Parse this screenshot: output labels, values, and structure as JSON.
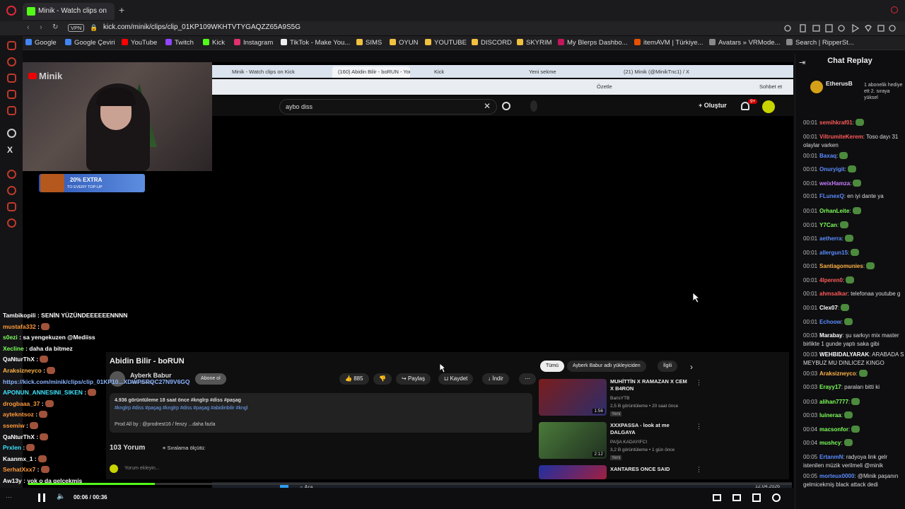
{
  "outer_browser": {
    "tab_title": "Minik - Watch clips on",
    "url": "kick.com/minik/clips/clip_01KP109WKHTVTYGAQZZ65A9S5G",
    "vpn_label": "VPN",
    "bookmarks": [
      "Google",
      "Google Çeviri",
      "YouTube",
      "Twitch",
      "Kick",
      "Instagram",
      "TikTok - Make You...",
      "SIMS",
      "OYUN",
      "YOUTUBE",
      "DISCORD",
      "SKYRIM",
      "My Blerps Dashbo...",
      "itemAVM | Türkiye...",
      "Avatars » VRMode...",
      "Search | RipperSt..."
    ],
    "bookmark_colors": [
      "#4285f4",
      "#4285f4",
      "#ff0000",
      "#9146ff",
      "#53fc18",
      "#e1306c",
      "#eeeeee",
      "#f0c040",
      "#f0c040",
      "#f0c040",
      "#f0c040",
      "#f0c040",
      "#c2185b",
      "#e65100",
      "#888888",
      "#888888"
    ]
  },
  "stream": {
    "channel_watermark": "Minik",
    "promo_text": "20% EXTRA",
    "promo_sub": "TO EVERY TOP-UP",
    "inner_tabs": [
      "Minik - Watch clips on Kick",
      "(160) Abidin Bilir - boRUN - YouT",
      "Kick",
      "Yeni sekme",
      "(21) Minik (@MinikTnc1) / X"
    ],
    "inner_toolbar_right": [
      "Özetle",
      "Sohbet et"
    ],
    "youtube": {
      "search_query": "aybo diss",
      "create_label": "Oluştur",
      "notif_count": "9+",
      "video_title": "Abidin Bilir - boRUN",
      "channel_name": "Ayberk Babur",
      "subscribe_label": "Abone ol",
      "subscribers": "Yeni abone",
      "likes": "885",
      "share_label": "Paylaş",
      "save_label": "Kaydet",
      "download_label": "İndir",
      "views_line": "4.936 görüntüleme  18 saat önce  #knglrp #diss #paşag",
      "tags_line": "#knglrp #diss #paşag #knglrp #diss #paşag #abidinbilir #kngl",
      "prod_line": "Prod All by : @prodrest16 / fenzy ...daha fazla",
      "comments_count": "103 Yorum",
      "sort_label": "Sıralama ölçütü:",
      "comment_placeholder": "Yorum ekleyin...",
      "chips": [
        "Tümü",
        "Ayberk Babur adlı yükleyiciden",
        "İlgili"
      ],
      "recommended": [
        {
          "title": "MUHİTTİN X RAMAZAN X CEM X B4RON",
          "channel": "BarisYTB",
          "meta": "2,5 B görüntüleme • 20 saat önce",
          "badge": "Yeni",
          "duration": "1:56"
        },
        {
          "title": "XXXPASSA - look at me DALGAYA",
          "channel": "PAŞA KADAYIFCI",
          "meta": "3,2 B görüntüleme • 1 gün önce",
          "badge": "Yeni",
          "duration": "2:12"
        },
        {
          "title": "XANTARES ONCE SAID",
          "channel": "",
          "meta": "",
          "badge": "",
          "duration": ""
        }
      ]
    },
    "overlay_chat": [
      {
        "user": "Tambikopili",
        "text": " : SENİN YÜZÜNDEEEEEENNNN",
        "color": "#ffffff"
      },
      {
        "user": "mustafa332",
        "text": " :",
        "color": "#ff9a3c"
      },
      {
        "user": "s0ezi",
        "text": " : sa yengekuzen @Mediiss",
        "color": "#7dff5a"
      },
      {
        "user": "Xecline",
        "text": " : daha da bitmez",
        "color": "#7dff5a"
      },
      {
        "user": "QaNturThX",
        "text": " :",
        "color": "#ffffff"
      },
      {
        "user": "Araksizneyco",
        "text": " :",
        "color": "#ffb347"
      },
      {
        "user": "https://kick.com/minik/clips/clip_01KP10...XDWPSRQC27N9V6GQ",
        "text": "",
        "color": "#8ab4ff"
      },
      {
        "user": "APONUN_ANNESINI_SIKEN",
        "text": " :",
        "color": "#3de5ff"
      },
      {
        "user": "drogbaaa_37",
        "text": " :",
        "color": "#ff9a3c"
      },
      {
        "user": "aytekntsoz",
        "text": " :",
        "color": "#ff9a3c"
      },
      {
        "user": "ssemiw",
        "text": " :",
        "color": "#ff9a3c"
      },
      {
        "user": "QaNturThX",
        "text": " :",
        "color": "#ffffff"
      },
      {
        "user": "Prxlen",
        "text": " :",
        "color": "#3de5ff"
      },
      {
        "user": "Kaanmx_1",
        "text": " :",
        "color": "#ffffff"
      },
      {
        "user": "SerhatXxx7",
        "text": " :",
        "color": "#ff9a3c"
      },
      {
        "user": "Aw13y",
        "text": " : yok o da gelcekmiş",
        "color": "#ffffff"
      }
    ],
    "taskbar_search": "Ara",
    "taskbar_date": "12.04.2026"
  },
  "chat_replay": {
    "title": "Chat Replay",
    "gift_user": "EtherusB",
    "gift_text": "1 abonelik hediye ett 2. sıraya yüksel",
    "messages": [
      {
        "time": "00:01",
        "user": "semihkraf01",
        "text": ":",
        "color": "#ff5a5a",
        "emote": true
      },
      {
        "time": "00:01",
        "user": "ViltrumiteKerem",
        "text": ": Toso dayı 31 olaylar varken",
        "color": "#ff5a5a",
        "emote": false
      },
      {
        "time": "00:01",
        "user": "Baxaq",
        "text": ":",
        "color": "#5b8cff",
        "emote": true
      },
      {
        "time": "00:01",
        "user": "Onuryigit",
        "text": ":",
        "color": "#5b8cff",
        "emote": true
      },
      {
        "time": "00:01",
        "user": "weixHamza",
        "text": ":",
        "color": "#c77dff",
        "emote": true
      },
      {
        "time": "00:01",
        "user": "FLunexQ",
        "text": ": en iyi dante ya",
        "color": "#5b8cff",
        "emote": false
      },
      {
        "time": "00:01",
        "user": "OrhanLeite",
        "text": ":",
        "color": "#7dff5a",
        "emote": true
      },
      {
        "time": "00:01",
        "user": "Y7Can",
        "text": ":",
        "color": "#7dff5a",
        "emote": true
      },
      {
        "time": "00:01",
        "user": "aetherra",
        "text": ":",
        "color": "#5b8cff",
        "emote": true
      },
      {
        "time": "00:01",
        "user": "allergun15",
        "text": ":",
        "color": "#5b8cff",
        "emote": true
      },
      {
        "time": "00:01",
        "user": "Santiagomunies",
        "text": ":",
        "color": "#ffb347",
        "emote": true
      },
      {
        "time": "00:01",
        "user": "4lperen0",
        "text": ":",
        "color": "#ff5a5a",
        "emote": true
      },
      {
        "time": "00:01",
        "user": "ahmsalkar",
        "text": ": telefonaa youtube g",
        "color": "#ff5a5a",
        "emote": false
      },
      {
        "time": "00:01",
        "user": "Clex07",
        "text": ":",
        "color": "#ffffff",
        "emote": true
      },
      {
        "time": "00:01",
        "user": "Echoow",
        "text": ":",
        "color": "#5b8cff",
        "emote": true
      },
      {
        "time": "00:03",
        "user": "Marabay",
        "text": ": şu sarkıyı mix master birlikte 1 gunde yaptı saka gibi",
        "color": "#ffffff",
        "emote": false
      },
      {
        "time": "00:03",
        "user": "WEHBIDALYARAK",
        "text": ": ARABADA S MEYBUZ MU DINLICEZ KINGO",
        "color": "#ffffff",
        "emote": false
      },
      {
        "time": "00:03",
        "user": "Araksizneyco",
        "text": ":",
        "color": "#ffb347",
        "emote": true
      },
      {
        "time": "00:03",
        "user": "Erayy17",
        "text": ": paraları bitti ki",
        "color": "#7dff5a",
        "emote": false
      },
      {
        "time": "00:03",
        "user": "alihan7777",
        "text": ":",
        "color": "#7dff5a",
        "emote": true
      },
      {
        "time": "00:03",
        "user": "luineraa",
        "text": ":",
        "color": "#7dff5a",
        "emote": true
      },
      {
        "time": "00:04",
        "user": "macsonfor",
        "text": ":",
        "color": "#7dff5a",
        "emote": true
      },
      {
        "time": "00:04",
        "user": "mushcy",
        "text": ":",
        "color": "#7dff5a",
        "emote": true
      },
      {
        "time": "00:05",
        "user": "ErtanmN",
        "text": ": radyoya link gelr istenilen müzik verilmeli @minik",
        "color": "#5b8cff",
        "emote": false
      },
      {
        "time": "00:05",
        "user": "morteux0000",
        "text": ": @Minik paşanın gelmicekmiş black attack dedi",
        "color": "#5b8cff",
        "emote": false
      }
    ]
  },
  "player": {
    "time": "00:06 / 00:36",
    "progress": 0.166
  },
  "colors": {
    "accent": "#53fc18",
    "background": "#0e0e10"
  }
}
